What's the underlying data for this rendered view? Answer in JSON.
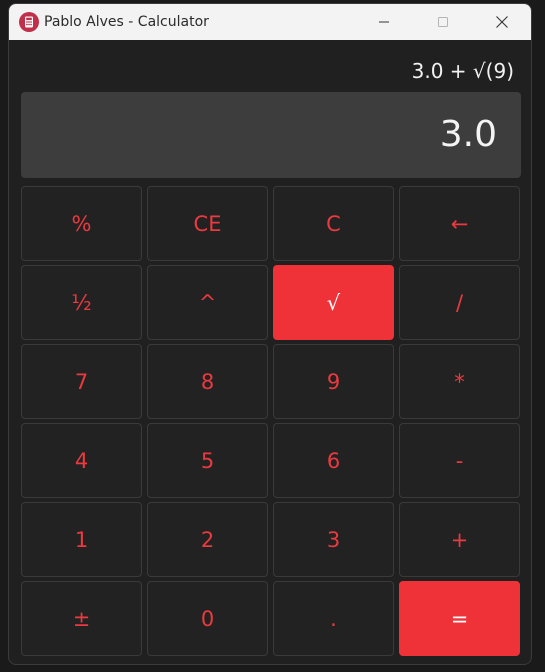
{
  "window": {
    "title": "Pablo Alves - Calculator",
    "controls": {
      "minimize": "minimize-icon",
      "maximize": "maximize-icon",
      "close": "close-icon"
    }
  },
  "calculator": {
    "expression": "3.0 + √(9)",
    "display": "3.0",
    "keys": [
      {
        "id": "percent",
        "label": "%",
        "style": "normal"
      },
      {
        "id": "clear-entry",
        "label": "CE",
        "style": "normal"
      },
      {
        "id": "clear",
        "label": "C",
        "style": "normal"
      },
      {
        "id": "backspace",
        "label": "←",
        "style": "normal"
      },
      {
        "id": "half",
        "label": "½",
        "style": "normal"
      },
      {
        "id": "power",
        "label": "^",
        "style": "normal"
      },
      {
        "id": "sqrt",
        "label": "√",
        "style": "accent"
      },
      {
        "id": "divide",
        "label": "/",
        "style": "normal"
      },
      {
        "id": "seven",
        "label": "7",
        "style": "normal"
      },
      {
        "id": "eight",
        "label": "8",
        "style": "normal"
      },
      {
        "id": "nine",
        "label": "9",
        "style": "normal"
      },
      {
        "id": "multiply",
        "label": "*",
        "style": "normal"
      },
      {
        "id": "four",
        "label": "4",
        "style": "normal"
      },
      {
        "id": "five",
        "label": "5",
        "style": "normal"
      },
      {
        "id": "six",
        "label": "6",
        "style": "normal"
      },
      {
        "id": "subtract",
        "label": "-",
        "style": "normal"
      },
      {
        "id": "one",
        "label": "1",
        "style": "normal"
      },
      {
        "id": "two",
        "label": "2",
        "style": "normal"
      },
      {
        "id": "three",
        "label": "3",
        "style": "normal"
      },
      {
        "id": "add",
        "label": "+",
        "style": "normal"
      },
      {
        "id": "negate",
        "label": "±",
        "style": "normal"
      },
      {
        "id": "zero",
        "label": "0",
        "style": "normal"
      },
      {
        "id": "decimal",
        "label": ".",
        "style": "normal"
      },
      {
        "id": "equals",
        "label": "=",
        "style": "accent"
      }
    ]
  },
  "colors": {
    "accent": "#ee3238",
    "key_text": "#ea3a40",
    "background": "#202020",
    "display_bg": "#3d3d3d"
  }
}
